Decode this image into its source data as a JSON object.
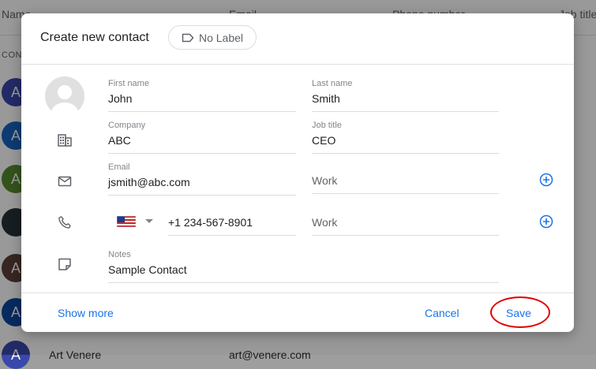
{
  "background": {
    "columns": [
      "Name",
      "Email",
      "Phone number",
      "Job title"
    ],
    "section": "CONT",
    "avatar_letter": "A",
    "partial_row_name": "Art Venere",
    "partial_row_email": "art@venere.com"
  },
  "dialog": {
    "title": "Create new contact",
    "label_chip": "No Label",
    "fields": {
      "first_name": {
        "label": "First name",
        "value": "John"
      },
      "last_name": {
        "label": "Last name",
        "value": "Smith"
      },
      "company": {
        "label": "Company",
        "value": "ABC"
      },
      "job_title": {
        "label": "Job title",
        "value": "CEO"
      },
      "email": {
        "label": "Email",
        "value": "jsmith@abc.com"
      },
      "email_type": "Work",
      "phone": "+1 234-567-8901",
      "phone_type": "Work",
      "notes": {
        "label": "Notes",
        "value": "Sample Contact"
      }
    },
    "footer": {
      "show_more": "Show more",
      "cancel": "Cancel",
      "save": "Save"
    }
  },
  "icons": {
    "company": "building-icon",
    "email": "mail-icon",
    "phone": "phone-icon",
    "notes": "note-icon",
    "add": "add-circle-icon",
    "label": "label-tag-icon",
    "flag": "us-flag-icon"
  },
  "colors": {
    "accent": "#1a73e8",
    "highlight_ring": "#e10000",
    "avatar_colors": [
      "#3949ab",
      "#1565c0",
      "#558b2f",
      "#263238",
      "#5d4037",
      "#0d47a1"
    ]
  }
}
